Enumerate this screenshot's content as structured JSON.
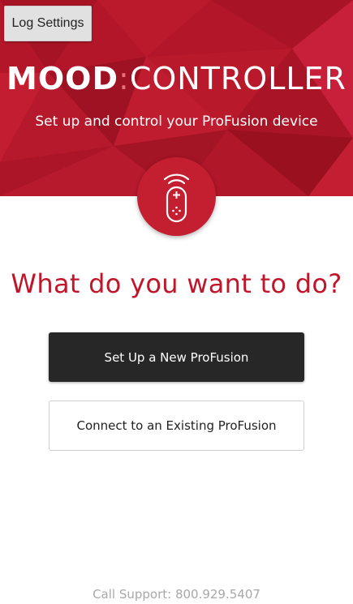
{
  "app": {
    "title_bold": "MOOD",
    "title_separator": ":",
    "title_light": "CONTROLLER",
    "subtitle": "Set up and control your ProFusion device"
  },
  "log_settings_label": "Log Settings",
  "badge_icon": "remote-control-icon",
  "question": "What do you want to do?",
  "actions": {
    "setup_label": "Set Up a New ProFusion",
    "connect_label": "Connect to an Existing ProFusion"
  },
  "support": {
    "text": "Call Support: 800.929.5407"
  },
  "colors": {
    "brand_red": "#b41728",
    "question_red": "#c0162a",
    "primary_button": "#272727",
    "support_text": "#a8a8a8"
  }
}
